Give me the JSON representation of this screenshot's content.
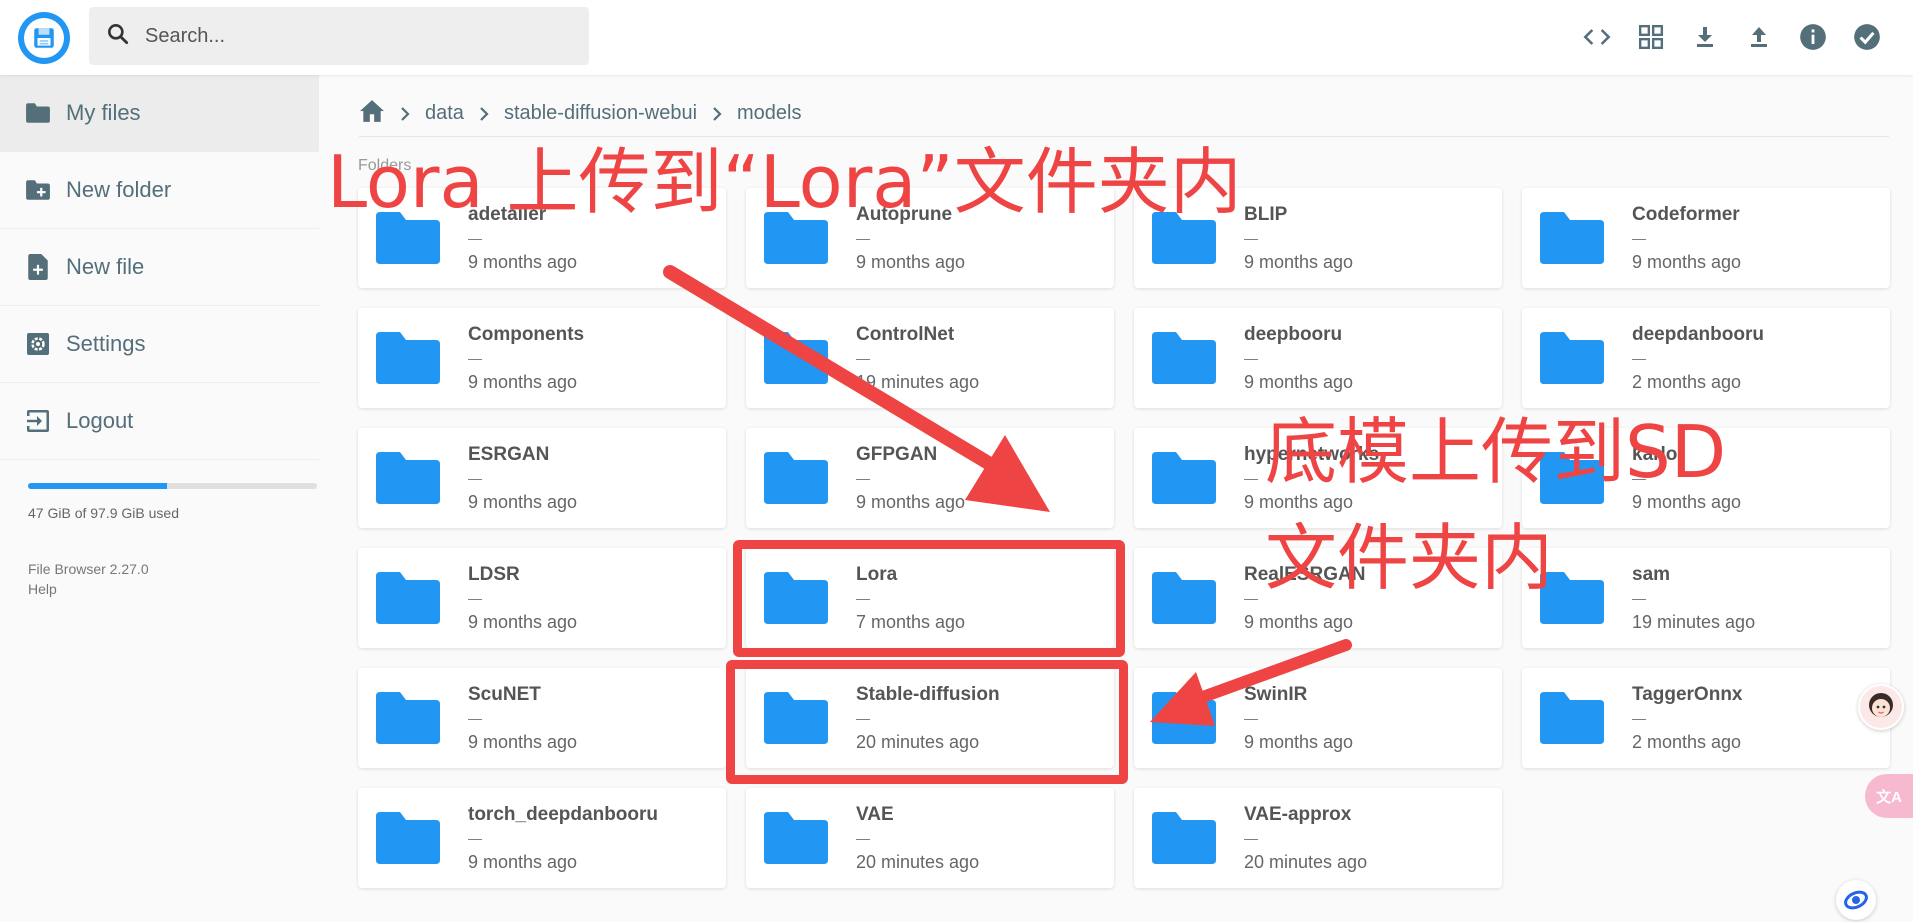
{
  "search": {
    "placeholder": "Search..."
  },
  "header": {
    "actions": [
      {
        "name": "code-view-icon"
      },
      {
        "name": "grid-view-icon"
      },
      {
        "name": "download-icon"
      },
      {
        "name": "upload-icon"
      },
      {
        "name": "info-icon"
      },
      {
        "name": "check-circle-icon"
      }
    ]
  },
  "sidebar": {
    "items": [
      {
        "label": "My files",
        "icon": "folder-icon"
      },
      {
        "label": "New folder",
        "icon": "create-new-folder-icon"
      },
      {
        "label": "New file",
        "icon": "note-add-icon"
      },
      {
        "label": "Settings",
        "icon": "settings-icon"
      },
      {
        "label": "Logout",
        "icon": "logout-icon"
      }
    ],
    "usage": {
      "text": "47 GiB of 97.9 GiB used",
      "fraction": 0.48
    },
    "version": "File Browser 2.27.0",
    "help": "Help"
  },
  "breadcrumb": [
    "data",
    "stable-diffusion-webui",
    "models"
  ],
  "section_label": "Folders",
  "folders": [
    {
      "name": "adetailer",
      "size": "—",
      "date": "9 months ago"
    },
    {
      "name": "Autoprune",
      "size": "—",
      "date": "9 months ago"
    },
    {
      "name": "BLIP",
      "size": "—",
      "date": "9 months ago"
    },
    {
      "name": "Codeformer",
      "size": "—",
      "date": "9 months ago"
    },
    {
      "name": "Components",
      "size": "—",
      "date": "9 months ago"
    },
    {
      "name": "ControlNet",
      "size": "—",
      "date": "19 minutes ago"
    },
    {
      "name": "deepbooru",
      "size": "—",
      "date": "9 months ago"
    },
    {
      "name": "deepdanbooru",
      "size": "—",
      "date": "2 months ago"
    },
    {
      "name": "ESRGAN",
      "size": "—",
      "date": "9 months ago"
    },
    {
      "name": "GFPGAN",
      "size": "—",
      "date": "9 months ago"
    },
    {
      "name": "hypernetworks",
      "size": "—",
      "date": "9 months ago"
    },
    {
      "name": "karlo",
      "size": "—",
      "date": "9 months ago"
    },
    {
      "name": "LDSR",
      "size": "—",
      "date": "9 months ago"
    },
    {
      "name": "Lora",
      "size": "—",
      "date": "7 months ago"
    },
    {
      "name": "RealESRGAN",
      "size": "—",
      "date": "9 months ago"
    },
    {
      "name": "sam",
      "size": "—",
      "date": "19 minutes ago"
    },
    {
      "name": "ScuNET",
      "size": "—",
      "date": "9 months ago"
    },
    {
      "name": "Stable-diffusion",
      "size": "—",
      "date": "20 minutes ago"
    },
    {
      "name": "SwinIR",
      "size": "—",
      "date": "9 months ago"
    },
    {
      "name": "TaggerOnnx",
      "size": "—",
      "date": "2 months ago"
    },
    {
      "name": "torch_deepdanbooru",
      "size": "—",
      "date": "9 months ago"
    },
    {
      "name": "VAE",
      "size": "—",
      "date": "20 minutes ago"
    },
    {
      "name": "VAE-approx",
      "size": "—",
      "date": "20 minutes ago"
    }
  ],
  "annotations": {
    "lora_note": "Lora 上传到“Lora”文件夹内",
    "sd_note_line1": "底模上传到SD",
    "sd_note_line2": "文件夹内",
    "color": "#ef4444"
  },
  "floating": {
    "translate_label": "文A"
  },
  "colors": {
    "accent": "#2196f3",
    "folder": "#2196f3",
    "annotation": "#ef4444"
  }
}
